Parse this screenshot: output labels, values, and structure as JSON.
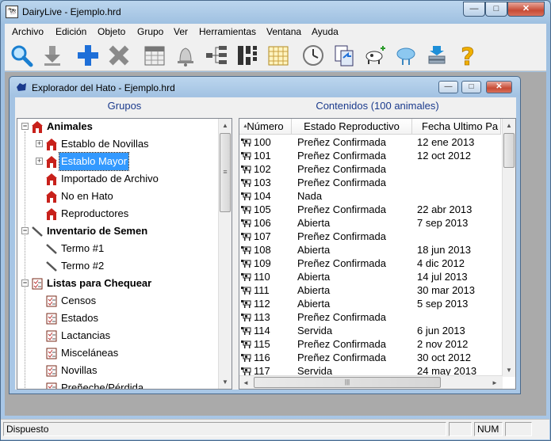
{
  "window": {
    "title": "DairyLive - Ejemplo.hrd",
    "min": "—",
    "max": "□",
    "close": "✕"
  },
  "menu": [
    "Archivo",
    "Edición",
    "Objeto",
    "Grupo",
    "Ver",
    "Herramientas",
    "Ventana",
    "Ayuda"
  ],
  "toolbar": [
    "search-icon",
    "download-icon",
    "add-icon",
    "delete-icon",
    "calendar-icon",
    "bell-icon",
    "tree-icon",
    "pedigree-icon",
    "calendar-grid-icon",
    "clock-icon",
    "copy-icon",
    "cow-add-icon",
    "cloud-sync-icon",
    "database-export-icon",
    "help-icon"
  ],
  "child": {
    "title": "Explorador del Hato - Ejemplo.hrd",
    "min": "—",
    "max": "□",
    "close": "✕"
  },
  "groups_header": "Grupos",
  "contents_header": "Contenidos (100 animales)",
  "tree": [
    {
      "label": "Animales",
      "level": 0,
      "bold": true,
      "icon": "barn-icon",
      "expander": "−"
    },
    {
      "label": "Establo de Novillas",
      "level": 1,
      "icon": "barn-icon",
      "expander": "+"
    },
    {
      "label": "Establo Mayor",
      "level": 1,
      "icon": "barn-icon",
      "expander": "+",
      "selected": true
    },
    {
      "label": "Importado de Archivo",
      "level": 1,
      "icon": "barn-icon"
    },
    {
      "label": "No en Hato",
      "level": 1,
      "icon": "barn-icon"
    },
    {
      "label": "Reproductores",
      "level": 1,
      "icon": "barn-icon"
    },
    {
      "label": "Inventario de Semen",
      "level": 0,
      "bold": true,
      "icon": "straw-icon",
      "expander": "−"
    },
    {
      "label": "Termo #1",
      "level": 1,
      "icon": "straw-icon"
    },
    {
      "label": "Termo #2",
      "level": 1,
      "icon": "straw-icon"
    },
    {
      "label": "Listas para Chequear",
      "level": 0,
      "bold": true,
      "icon": "checklist-icon",
      "expander": "−"
    },
    {
      "label": "Censos",
      "level": 1,
      "icon": "checklist-icon"
    },
    {
      "label": "Estados",
      "level": 1,
      "icon": "checklist-icon"
    },
    {
      "label": "Lactancias",
      "level": 1,
      "icon": "checklist-icon"
    },
    {
      "label": "Misceláneas",
      "level": 1,
      "icon": "checklist-icon"
    },
    {
      "label": "Novillas",
      "level": 1,
      "icon": "checklist-icon"
    },
    {
      "label": "Preñeche/Pérdida",
      "level": 1,
      "icon": "checklist-icon"
    }
  ],
  "columns": [
    "Número",
    "Estado Reproductivo",
    "Fecha Ultimo Pa"
  ],
  "rows": [
    [
      "100",
      "Preñez Confirmada",
      "12 ene 2013"
    ],
    [
      "101",
      "Preñez Confirmada",
      "12 oct 2012"
    ],
    [
      "102",
      "Preñez Confirmada",
      ""
    ],
    [
      "103",
      "Preñez Confirmada",
      ""
    ],
    [
      "104",
      "Nada",
      ""
    ],
    [
      "105",
      "Preñez Confirmada",
      "22 abr 2013"
    ],
    [
      "106",
      "Abierta",
      "7 sep 2013"
    ],
    [
      "107",
      "Preñez Confirmada",
      ""
    ],
    [
      "108",
      "Abierta",
      "18 jun 2013"
    ],
    [
      "109",
      "Preñez Confirmada",
      "4 dic 2012"
    ],
    [
      "110",
      "Abierta",
      "14 jul 2013"
    ],
    [
      "111",
      "Abierta",
      "30 mar 2013"
    ],
    [
      "112",
      "Abierta",
      "5 sep 2013"
    ],
    [
      "113",
      "Preñez Confirmada",
      ""
    ],
    [
      "114",
      "Servida",
      "6 jun 2013"
    ],
    [
      "115",
      "Preñez Confirmada",
      "2 nov 2012"
    ],
    [
      "116",
      "Preñez Confirmada",
      "30 oct 2012"
    ],
    [
      "117",
      "Servida",
      "24 may 2013"
    ]
  ],
  "status": {
    "text": "Dispuesto",
    "num": "NUM"
  },
  "scroll": {
    "up": "▲",
    "down": "▼",
    "left": "◄",
    "right": "►",
    "grip": "≡",
    "hgrip": "|||"
  },
  "colors": {
    "accent": "#3399ff",
    "barn": "#c8211b",
    "header_text": "#1a3a8c"
  }
}
